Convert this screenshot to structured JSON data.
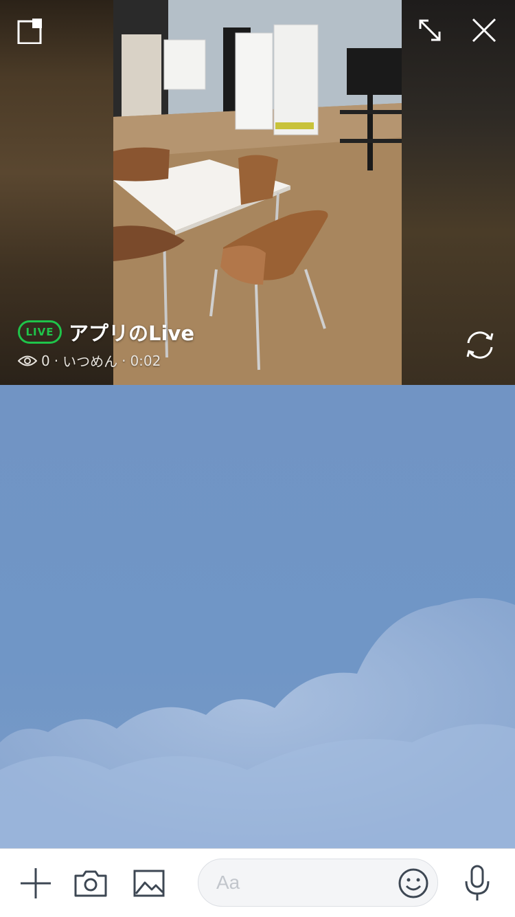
{
  "live": {
    "badge": "LIVE",
    "title": "アプリのLive",
    "viewers": "0",
    "host": "いつめん",
    "elapsed": "0:02",
    "separator": "·",
    "badge_color": "#1fc44a"
  },
  "controls": {
    "pip_icon": "picture-in-picture-icon",
    "expand_icon": "expand-icon",
    "close_icon": "close-icon",
    "flip_icon": "switch-camera-icon"
  },
  "input_bar": {
    "placeholder": "Aa",
    "plus_icon": "plus-icon",
    "camera_icon": "camera-icon",
    "image_icon": "image-icon",
    "emoji_icon": "emoji-icon",
    "mic_icon": "microphone-icon",
    "icon_color": "#3d4753"
  }
}
